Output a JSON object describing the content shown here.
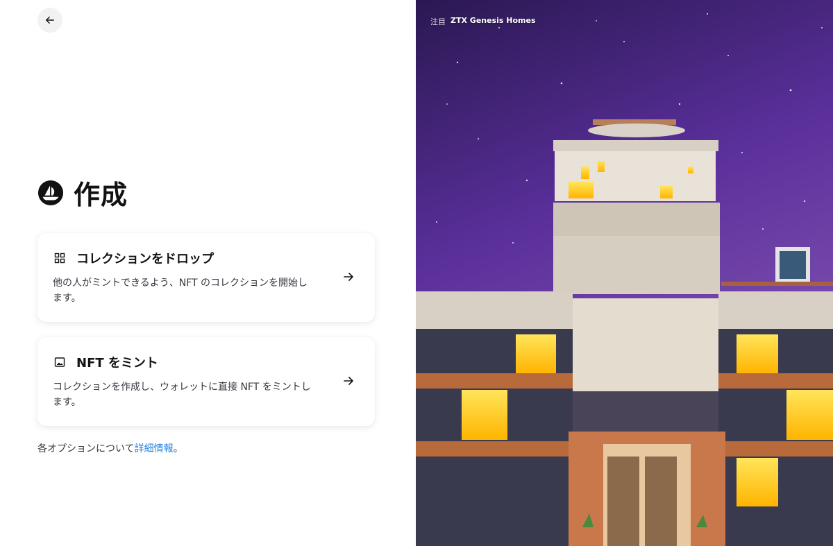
{
  "back_button": {
    "icon": "arrow-left-icon"
  },
  "header": {
    "title": "作成",
    "logo": "opensea-logo-icon"
  },
  "options": [
    {
      "icon": "grid-icon",
      "title": "コレクションをドロップ",
      "description": "他の人がミントできるよう、NFT のコレクションを開始します。",
      "arrow": "arrow-right-icon"
    },
    {
      "icon": "image-icon",
      "title": "NFT をミント",
      "description": "コレクションを作成し、ウォレットに直接 NFT をミントします。",
      "arrow": "arrow-right-icon"
    }
  ],
  "footer": {
    "text": "各オプションについて",
    "link": "詳細情報",
    "suffix": "。"
  },
  "featured": {
    "tag": "注目",
    "name": "ZTX Genesis Homes"
  },
  "colors": {
    "accent_link": "#2081e2",
    "text_primary": "#121212",
    "text_secondary": "#353840",
    "window_glow": "#ffd21f",
    "sky": "#4a2a8a"
  }
}
